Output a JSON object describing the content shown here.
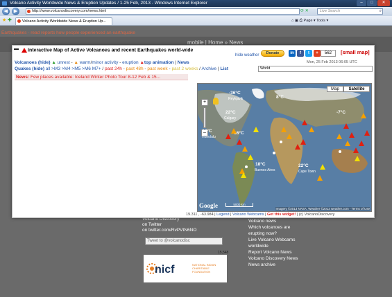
{
  "window": {
    "title": "Volcano Activity Worldwide News & Eruption Updates / 1-25 Feb, 2013 - Windows Internet Explorer",
    "minimize": "–",
    "maximize": "□",
    "close": "✕"
  },
  "nav": {
    "back": "◀",
    "forward": "▶",
    "url": "http://www.volcanodiscovery.com/news.html",
    "search_placeholder": "Live Search",
    "search_icon": "⌕"
  },
  "tabs": [
    {
      "label": "Volcano Activity Worldwide News & Eruption Up..."
    }
  ],
  "toolbar": {
    "home": "⌂",
    "feeds": "▣",
    "print": "⎙",
    "page_label": "Page ▾",
    "tools_label": "Tools ▾"
  },
  "page": {
    "banner": "Earthquakes - read reports how people experienced an earthquake",
    "mobile_text": "mobile | Home » News"
  },
  "popup": {
    "title": "Interactive Map of Active Volcanoes and recent Earthquakes world-wide",
    "hide_weather": "hide weather",
    "donate": "Donate",
    "share_count": "562",
    "small_map": "[small map]",
    "datetime": "Mon, 25 Feb 2013 06:05 UTC",
    "volcanoes_label": "Volcanoes (hide)",
    "legend_unrest": "unrest",
    "legend_warm": "warm",
    "legend_minor": "minor activity",
    "legend_eruption": "eruption",
    "legend_anim": "top animation",
    "news_link": "News",
    "quakes_label": "Quakes (hide)",
    "quake_filters": [
      "all",
      ">M3",
      ">M4",
      ">M5",
      ">M6",
      "M7+"
    ],
    "quake_periods": [
      "past 24h",
      "past 48h",
      "past week",
      "past 2 weeks"
    ],
    "archive": "Archive",
    "list": "List",
    "region": "World",
    "news_label": "News:",
    "news_text": "Few places available: Iceland Winter Photo Tour 8-12 Feb & 15...",
    "coords": "19.311 , -63.984",
    "legend_link": "Legend",
    "webcams_link": "Volcano Webcams",
    "widget_link": "Get this widget!",
    "copyright": "(c) VolcanoDiscovery"
  },
  "map": {
    "map_btn": "Map",
    "satellite_btn": "Satellite",
    "zoom_in": "+",
    "temps": [
      "-36°C",
      "8°C",
      "22°C",
      "22°C",
      "-16°C",
      "-7°C",
      "18°C",
      "22°C"
    ],
    "cities": [
      "Reykjavik",
      "Calgary",
      "Honolulu",
      "Buenos Aires",
      "Cape Town"
    ],
    "google": "Google",
    "scale": "5000 km",
    "attribution": "Imagery ©2013 NASA, Weather ©2013 weather.com - Terms of Use"
  },
  "side": {
    "twitter_lines": [
      "Volcano Discovery",
      "on Twitter",
      "on twitter.com/RvPVtN6NO"
    ],
    "tweet_placeholder": "Tweet to @volcanodisc",
    "count": "15,548",
    "nicf": "nicf",
    "nicf_sub": "NATIONAL INDIAN CHARITABLE FOUNDATION",
    "right_links": [
      "Volcano news",
      "Which volcanoes are",
      "erupting now?",
      "Live Volcano Webcams",
      "worldwide",
      "Report Volcano News",
      "Volcano Discovery News",
      "News archive"
    ]
  }
}
